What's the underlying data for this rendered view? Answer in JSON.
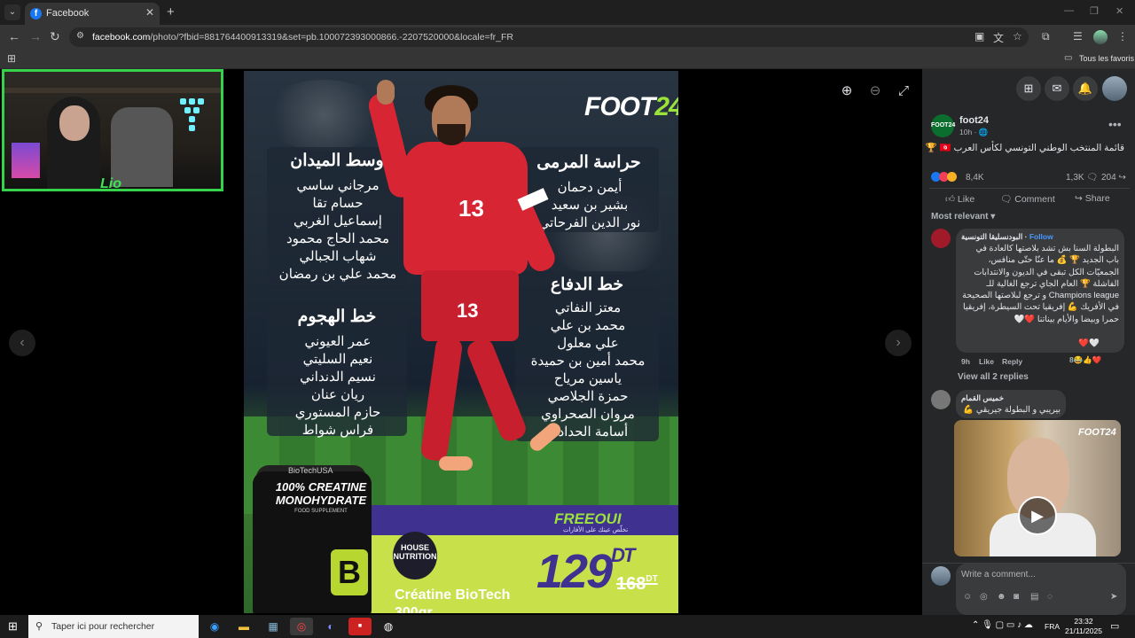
{
  "browser": {
    "tab_title": "Facebook",
    "tab_favicon": "f",
    "url_host": "facebook.com",
    "url_path": "/photo/?fbid=881764400913319&set=pb.100072393000866.-2207520000&locale=fr_FR",
    "bookmarks_label": "Tous les favoris",
    "icons": [
      "tab-list-icon",
      "close-icon",
      "plus-icon",
      "back-icon",
      "forward-icon",
      "reload-icon",
      "site-info-icon",
      "cast-icon",
      "translate-icon",
      "star-icon",
      "extensions-icon",
      "sidepanel-icon",
      "profile-avatar",
      "kebab-menu-icon",
      "apps-grid-icon",
      "folder-icon"
    ]
  },
  "photo": {
    "logo_main": "FOOT",
    "logo_num": "24",
    "goalkeepers": {
      "title": "حراسة المرمى",
      "players": [
        "أيمن دحمان",
        "بشير بن سعيد",
        "نور الدين الفرحاتي"
      ]
    },
    "midfield": {
      "title": "وسط الميدان",
      "players": [
        "مرجاني ساسي",
        "حسام تقا",
        "إسماعيل الغربي",
        "محمد الحاج محمود",
        "شهاب الجبالي",
        "محمد علي بن رمضان"
      ]
    },
    "defense": {
      "title": "خط الدفاع",
      "players": [
        "معتز النفاتي",
        "محمد بن علي",
        "علي معلول",
        "محمد أمين بن حميدة",
        "ياسين مرياح",
        "حمزة الجلاصي",
        "مروان الصحراوي",
        "أسامة الحدادي"
      ]
    },
    "attack": {
      "title": "خط الهجوم",
      "players": [
        "عمر العيوني",
        "نعيم السليتي",
        "نسيم الدنداني",
        "ريان عنان",
        "حازم المستوري",
        "فراس شواط"
      ]
    },
    "jersey_number": "13",
    "ad": {
      "jar_brand": "BioTechUSA",
      "jar_label": "100% CREATINE MONOHYDRATE",
      "jar_sub": "FOOD SUPPLEMENT",
      "jar_letter": "B",
      "store": "HOUSE NUTRITION",
      "partner": "FREEOUI",
      "partner_sub": "تخلّص عينك على الأفارات",
      "product": "Créatine BioTech",
      "size": "300gr",
      "price": "129",
      "price_unit": "DT",
      "old_price": "168",
      "old_unit": "DT"
    }
  },
  "viewer_controls": [
    "zoom-in-icon",
    "zoom-out-icon",
    "fullscreen-icon",
    "prev-arrow-icon",
    "next-arrow-icon"
  ],
  "webcam": {
    "tag": "Lio"
  },
  "side": {
    "page_name": "foot24",
    "page_avatar_text": "FOOT24",
    "post_time": "10h · 🌐",
    "caption": "قائمة المنتخب الوطني التونسي لكأس العرب 🇹🇳 🏆",
    "reaction_count": "8,4K",
    "comment_count": "1,3K",
    "share_count": "204",
    "actions": {
      "like": "Like",
      "comment": "Comment",
      "share": "Share"
    },
    "sort_label": "Most relevant ▾",
    "comments": [
      {
        "author": "البودنسليقا التونسية",
        "follow": "Follow",
        "text": "البطولة السنا بش تشد بلاصتها كالعادة في باب الجديد 🏆 💰 ما عنّا حتّى منافس، الجمعيّات الكل تبقى في الديون والانتدابات الفاشلة 🏆 العام الجاي ترجع الغالية للـ Champions league و ترجع لبلاصتها الصحيحة في الأفريك 💪 إفريقيا تحت السيطرة، إفريقيا حمرا وبيضا والأيام بيناتنا ❤️🤍",
        "hearts": "🤍❤️",
        "time": "9h",
        "like": "Like",
        "reply": "Reply",
        "reacts": "8😂👍❤️"
      },
      {
        "author": "خميس القمام",
        "text": "بيريبي و البطولة جيريقي 💪"
      }
    ],
    "view_replies": "View all 2 replies",
    "video_logo": "FOOT24",
    "composer_placeholder": "Write a comment..."
  },
  "taskbar": {
    "search_placeholder": "Taper ici pour rechercher",
    "lang": "FRA",
    "time": "23:32",
    "date": "21/11/2025"
  }
}
